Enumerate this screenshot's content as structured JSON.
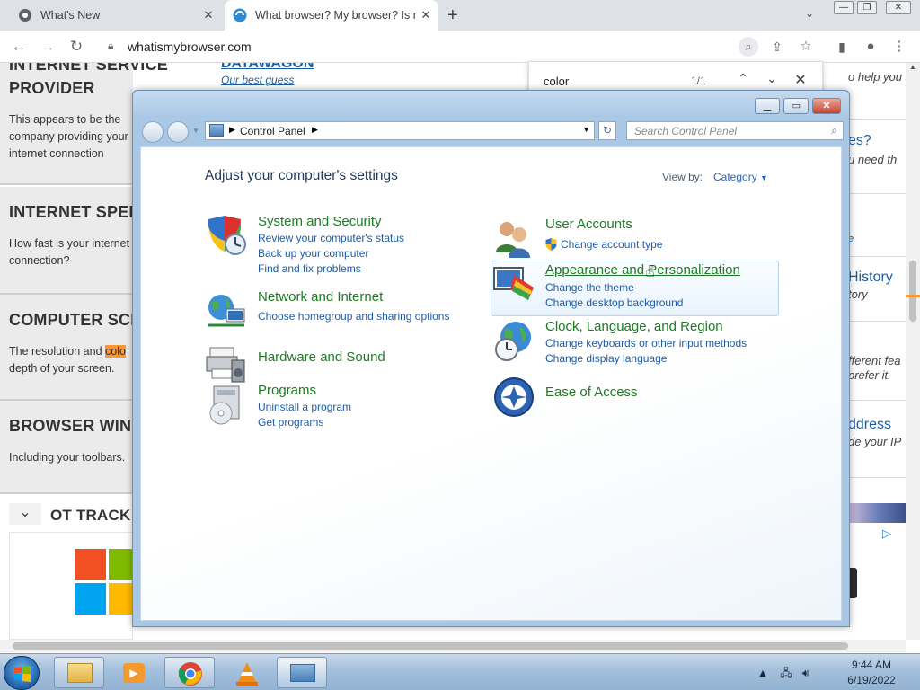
{
  "browser": {
    "tabs": [
      {
        "title": "What's New"
      },
      {
        "title": "What browser? My browser? Is m"
      }
    ],
    "url": "whatismybrowser.com",
    "find": {
      "query": "color",
      "count": "1/1"
    }
  },
  "page": {
    "link_col": {
      "title": "DATAWAGON",
      "sub": "Our best guess"
    },
    "sections": [
      {
        "title": "INTERNET SERVICE PROVIDER",
        "title_line1": "INTERNET SERVICE",
        "title_line2": "PROVIDER",
        "body": "This appears to be the company providing your internet connection"
      },
      {
        "title": "INTERNET SPEE",
        "body": "How fast is your internet connection?"
      },
      {
        "title": "COMPUTER SCI",
        "body_pre": "The resolution and ",
        "body_hl": "colo",
        "body_post": "depth of your screen."
      },
      {
        "title": "BROWSER WINI",
        "body": "Including your toolbars."
      },
      {
        "title": "OT TRACK"
      }
    ],
    "right_snippets": [
      {
        "title": "",
        "sub": "o help you so"
      },
      {
        "title": "es?",
        "sub": "u need th"
      },
      {
        "title": "",
        "sub": "e"
      },
      {
        "title": "History",
        "sub": "tory"
      },
      {
        "title": "fferent fea",
        "sub": "prefer it."
      },
      {
        "title": "ddress",
        "sub": "de your IP"
      }
    ]
  },
  "control_panel": {
    "breadcrumb": "Control Panel",
    "search_placeholder": "Search Control Panel",
    "heading": "Adjust your computer's settings",
    "view_by_label": "View by:",
    "view_by_value": "Category",
    "left": [
      {
        "title": "System and Security",
        "links": [
          "Review your computer's status",
          "Back up your computer",
          "Find and fix problems"
        ]
      },
      {
        "title": "Network and Internet",
        "links": [
          "Choose homegroup and sharing options"
        ]
      },
      {
        "title": "Hardware and Sound",
        "links": []
      },
      {
        "title": "Programs",
        "links": [
          "Uninstall a program",
          "Get programs"
        ]
      }
    ],
    "right": [
      {
        "title": "User Accounts",
        "links": [
          "Change account type"
        ]
      },
      {
        "title": "Appearance and Personalization",
        "links": [
          "Change the theme",
          "Change desktop background"
        ]
      },
      {
        "title": "Clock, Language, and Region",
        "links": [
          "Change keyboards or other input methods",
          "Change display language"
        ]
      },
      {
        "title": "Ease of Access",
        "links": []
      }
    ]
  },
  "taskbar": {
    "time": "9:44 AM",
    "date": "6/19/2022"
  },
  "colors": {
    "category_title": "#1e7a24",
    "category_link": "#1e5ca8",
    "find_highlight": "#ff9632",
    "window_frame": "#a9c8e6"
  }
}
